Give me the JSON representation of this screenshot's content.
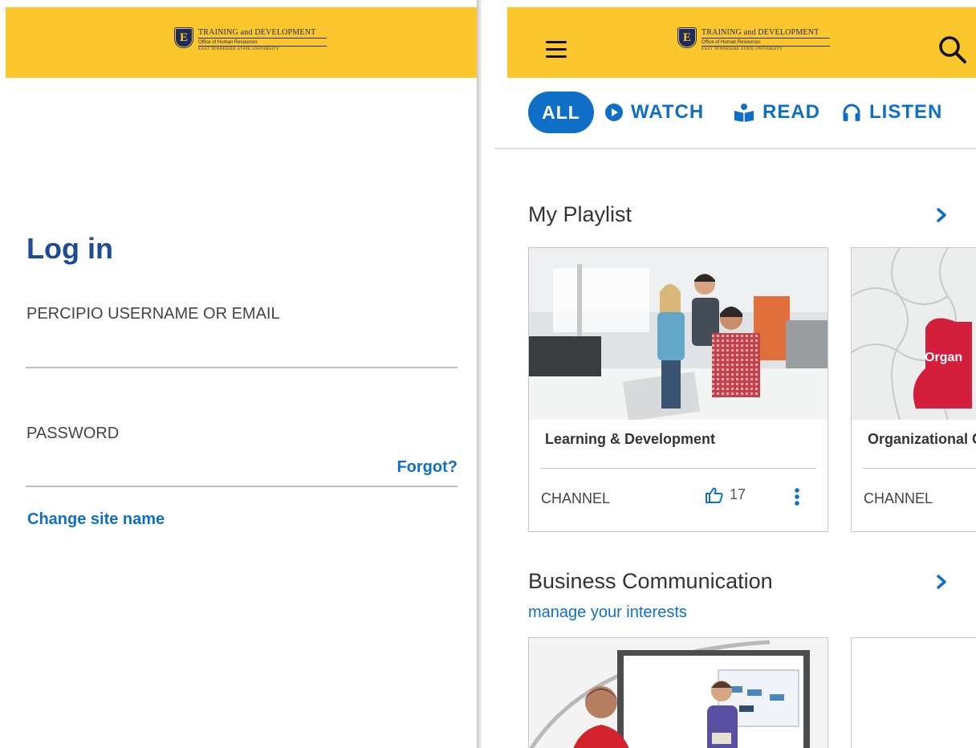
{
  "left_screen": {
    "brand": {
      "line1": "TRAINING and DEVELOPMENT",
      "line2": "Office of Human Resources",
      "line3": "EAST TENNESSEE STATE UNIVERSITY",
      "shield_letter": "E"
    },
    "title": "Log in",
    "username_label": "PERCIPIO USERNAME OR EMAIL",
    "password_label": "PASSWORD",
    "forgot_label": "Forgot?",
    "change_site_label": "Change site name"
  },
  "right_screen": {
    "brand": {
      "line1": "TRAINING and DEVELOPMENT",
      "line2": "Office of Human Resources",
      "line3": "EAST TENNESSEE STATE UNIVERSITY",
      "shield_letter": "E"
    },
    "filters": {
      "all": "ALL",
      "watch": "WATCH",
      "read": "READ",
      "listen": "LISTEN"
    },
    "sections": {
      "playlist": {
        "title": "My Playlist",
        "cards": [
          {
            "title": "Learning & Development",
            "type": "CHANNEL",
            "likes": "17"
          },
          {
            "title": "Organizational C",
            "type": "CHANNEL",
            "image_text": "Organ"
          }
        ]
      },
      "business": {
        "title": "Business Communication",
        "manage_link": "manage your interests"
      }
    }
  },
  "colors": {
    "brand_yellow": "#fcc62d",
    "accent_blue": "#0f6fc6",
    "navy": "#1d2c5a",
    "title_blue": "#1d4b94"
  }
}
